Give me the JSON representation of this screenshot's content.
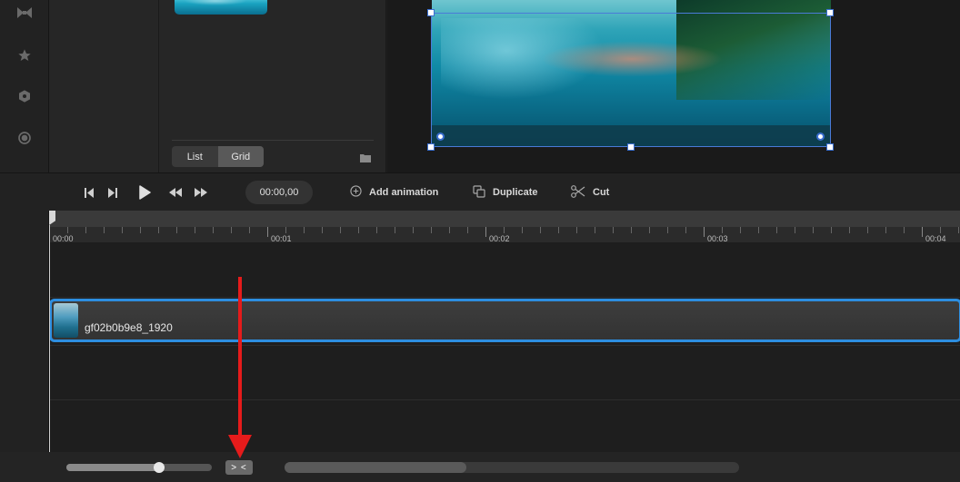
{
  "library": {
    "view_options": [
      "List",
      "Grid"
    ],
    "active_view": "Grid"
  },
  "toolbar": {
    "time": "00:00,00",
    "add_animation": "Add animation",
    "duplicate": "Duplicate",
    "cut": "Cut"
  },
  "timeline": {
    "ticks": [
      "00:00",
      "00:01",
      "00:02",
      "00:03",
      "00:04"
    ],
    "clip_name": "gf02b0b9e8_1920"
  },
  "zoom": {
    "level": 0.64
  },
  "scroll": {
    "position": 0.0,
    "visible_fraction": 0.4
  },
  "colors": {
    "accent": "#2d8ee0",
    "annotation": "#e51b1b",
    "selection": "#4a7bd8"
  },
  "icons": {
    "rail": [
      "bowtie-icon",
      "star-icon",
      "hexagon-icon",
      "record-icon"
    ],
    "transport": [
      "skip-to-start-icon",
      "step-forward-icon",
      "play-icon",
      "rewind-icon",
      "fast-forward-icon"
    ],
    "actions": [
      "add-circle-icon",
      "duplicate-icon",
      "scissors-icon"
    ]
  }
}
